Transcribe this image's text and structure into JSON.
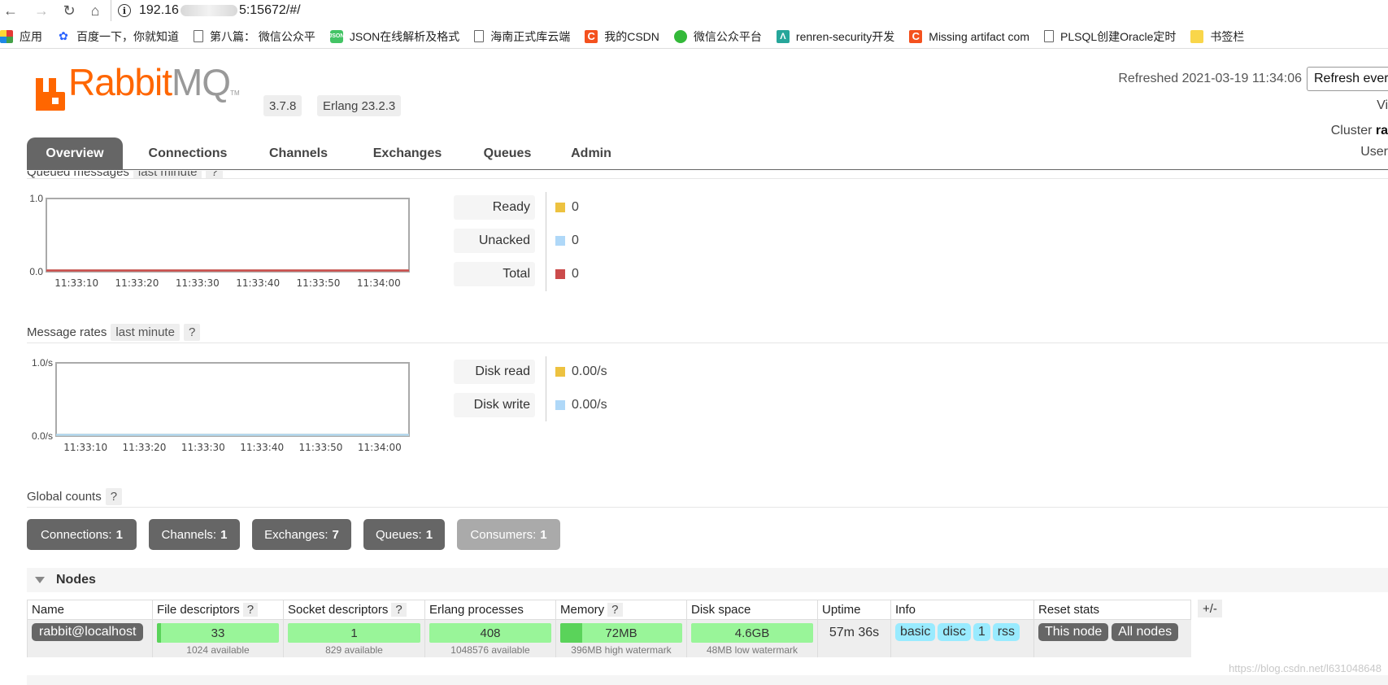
{
  "browser": {
    "url_prefix": "192.16",
    "url_suffix": "5:15672/#/",
    "bookmarks": [
      {
        "label": "应用",
        "icon": "apps-icon"
      },
      {
        "label": "百度一下，你就知道",
        "icon": "baidu-paw-icon"
      },
      {
        "label": "第八篇： 微信公众平",
        "icon": "page-icon"
      },
      {
        "label": "JSON在线解析及格式",
        "icon": "json-icon"
      },
      {
        "label": "海南正式库云端",
        "icon": "page-icon"
      },
      {
        "label": "我的CSDN",
        "icon": "csdn-icon"
      },
      {
        "label": "微信公众平台",
        "icon": "wechat-icon"
      },
      {
        "label": "renren-security开发",
        "icon": "renren-icon"
      },
      {
        "label": "Missing artifact com",
        "icon": "csdn-icon"
      },
      {
        "label": "PLSQL创建Oracle定时",
        "icon": "page-icon"
      },
      {
        "label": "书签栏",
        "icon": "folder-icon"
      }
    ]
  },
  "header": {
    "logo_rabbit": "Rabbit",
    "logo_mq": "MQ",
    "logo_tm": "TM",
    "version": "3.7.8",
    "erlang": "Erlang 23.2.3",
    "refreshed": "Refreshed 2021-03-19 11:34:06",
    "refresh_select": "Refresh every",
    "vhost_label": "Vi",
    "cluster_label": "Cluster",
    "cluster_value": "ra",
    "user_label": "User"
  },
  "tabs": [
    "Overview",
    "Connections",
    "Channels",
    "Exchanges",
    "Queues",
    "Admin"
  ],
  "queued": {
    "title": "Queued messages",
    "period": "last minute",
    "help": "?",
    "y_top": "1.0",
    "y_bottom": "0.0",
    "x_ticks": [
      "11:33:10",
      "11:33:20",
      "11:33:30",
      "11:33:40",
      "11:33:50",
      "11:34:00"
    ],
    "legend": [
      {
        "label": "Ready",
        "value": "0",
        "color": "#edc240"
      },
      {
        "label": "Unacked",
        "value": "0",
        "color": "#afd8f8"
      },
      {
        "label": "Total",
        "value": "0",
        "color": "#cb4b4b"
      }
    ]
  },
  "rates": {
    "title": "Message rates",
    "period": "last minute",
    "help": "?",
    "y_top": "1.0/s",
    "y_bottom": "0.0/s",
    "x_ticks": [
      "11:33:10",
      "11:33:20",
      "11:33:30",
      "11:33:40",
      "11:33:50",
      "11:34:00"
    ],
    "legend": [
      {
        "label": "Disk read",
        "value": "0.00/s",
        "color": "#edc240"
      },
      {
        "label": "Disk write",
        "value": "0.00/s",
        "color": "#afd8f8"
      }
    ]
  },
  "chart_data": [
    {
      "type": "line",
      "title": "Queued messages",
      "x": [
        "11:33:10",
        "11:33:20",
        "11:33:30",
        "11:33:40",
        "11:33:50",
        "11:34:00"
      ],
      "ylim": [
        0,
        1
      ],
      "series": [
        {
          "name": "Ready",
          "values": [
            0,
            0,
            0,
            0,
            0,
            0
          ]
        },
        {
          "name": "Unacked",
          "values": [
            0,
            0,
            0,
            0,
            0,
            0
          ]
        },
        {
          "name": "Total",
          "values": [
            0,
            0,
            0,
            0,
            0,
            0
          ]
        }
      ]
    },
    {
      "type": "line",
      "title": "Message rates",
      "x": [
        "11:33:10",
        "11:33:20",
        "11:33:30",
        "11:33:40",
        "11:33:50",
        "11:34:00"
      ],
      "ylim": [
        0,
        1
      ],
      "series": [
        {
          "name": "Disk read",
          "values": [
            0,
            0,
            0,
            0,
            0,
            0
          ]
        },
        {
          "name": "Disk write",
          "values": [
            0,
            0,
            0,
            0,
            0,
            0
          ]
        }
      ]
    }
  ],
  "global_counts": {
    "title": "Global counts",
    "help": "?",
    "items": [
      {
        "label": "Connections:",
        "value": "1"
      },
      {
        "label": "Channels:",
        "value": "1"
      },
      {
        "label": "Exchanges:",
        "value": "7"
      },
      {
        "label": "Queues:",
        "value": "1"
      },
      {
        "label": "Consumers:",
        "value": "1"
      }
    ]
  },
  "nodes": {
    "title": "Nodes",
    "plus_minus": "+/-",
    "headers": {
      "name": "Name",
      "fd": "File descriptors",
      "sd": "Socket descriptors",
      "ep": "Erlang processes",
      "mem": "Memory",
      "disk": "Disk space",
      "uptime": "Uptime",
      "info": "Info",
      "reset": "Reset stats",
      "help": "?"
    },
    "row": {
      "name": "rabbit@localhost",
      "fd_value": "33",
      "fd_sub": "1024 available",
      "fd_fraction": 0.03,
      "sd_value": "1",
      "sd_sub": "829 available",
      "ep_value": "408",
      "ep_sub": "1048576 available",
      "mem_value": "72MB",
      "mem_sub": "396MB high watermark",
      "mem_fraction": 0.18,
      "disk_value": "4.6GB",
      "disk_sub": "48MB low watermark",
      "uptime": "57m 36s",
      "info_tags": [
        "basic",
        "disc",
        "1",
        "rss"
      ],
      "reset_this": "This node",
      "reset_all": "All nodes"
    }
  },
  "watermark": "https://blog.csdn.net/l631048648"
}
